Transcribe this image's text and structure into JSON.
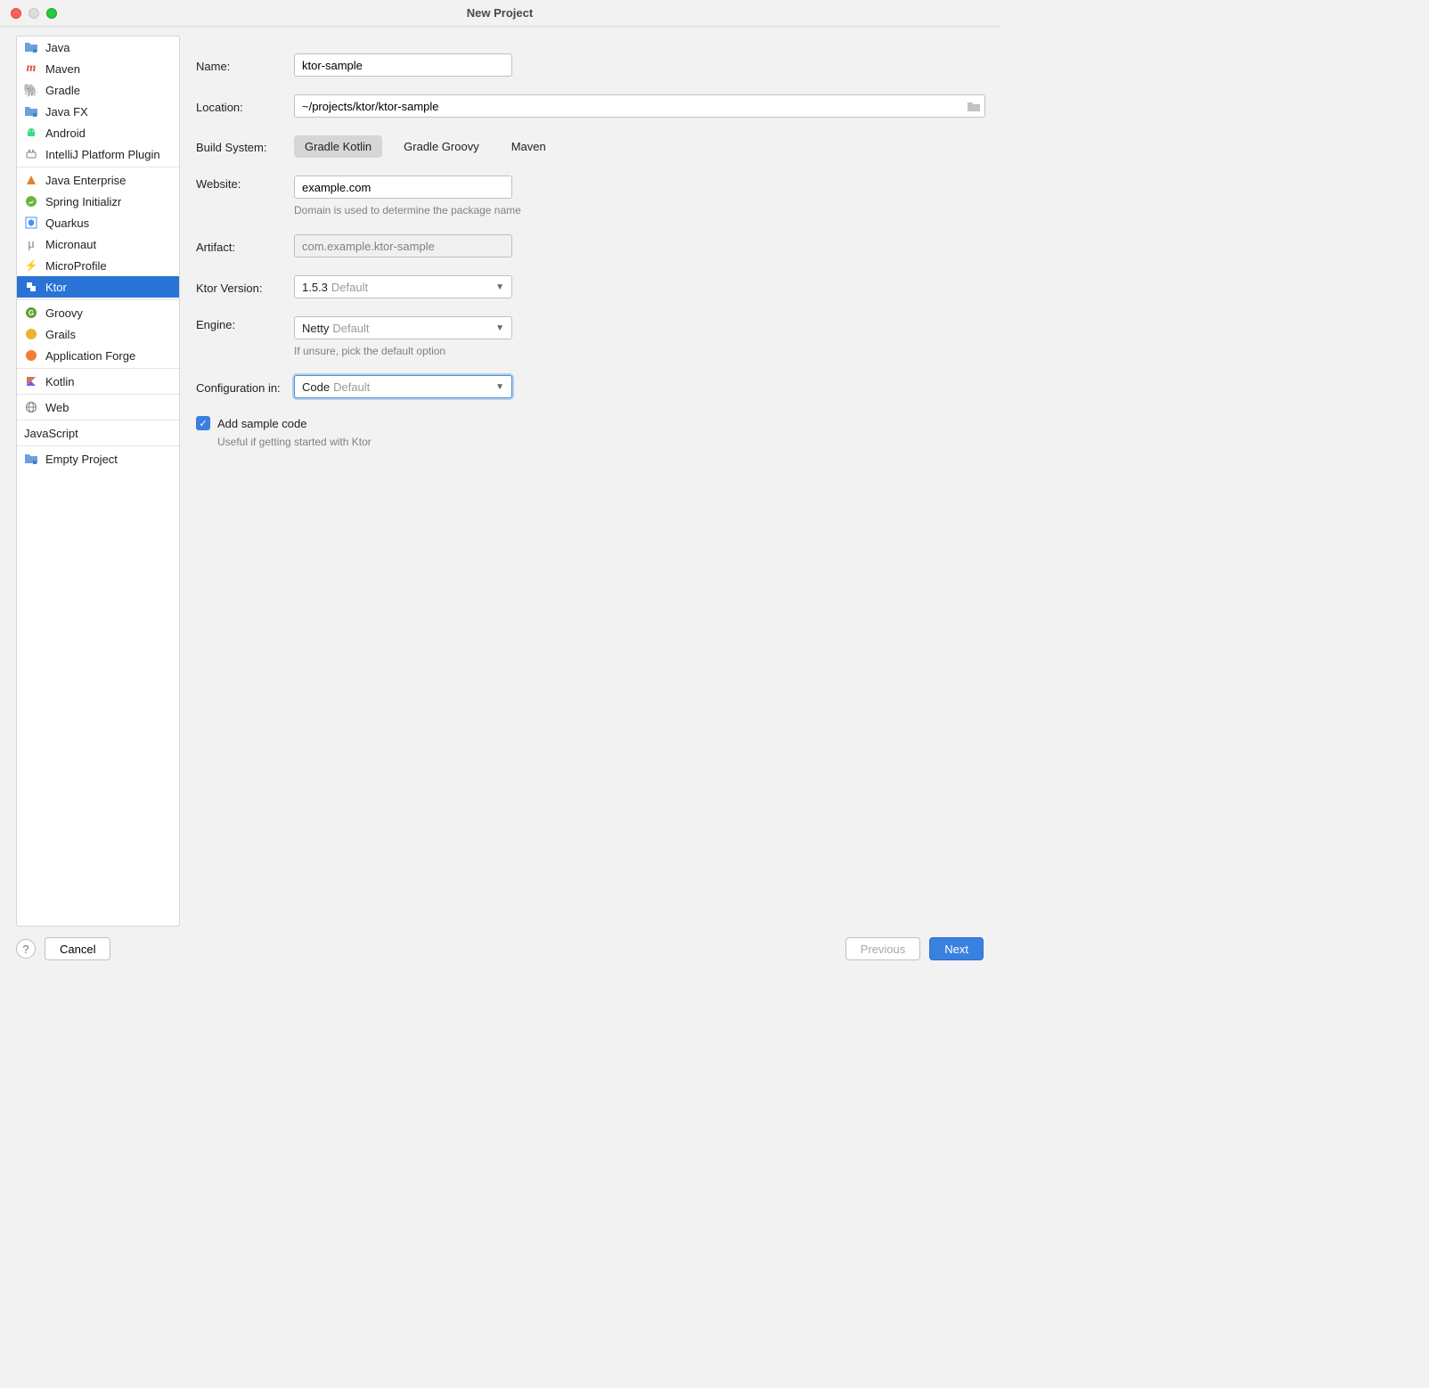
{
  "title": "New Project",
  "sidebar": {
    "groups": [
      [
        {
          "label": "Java",
          "icon": "folder-blue"
        },
        {
          "label": "Maven",
          "icon": "maven"
        },
        {
          "label": "Gradle",
          "icon": "gradle"
        },
        {
          "label": "Java FX",
          "icon": "folder-blue"
        },
        {
          "label": "Android",
          "icon": "android"
        },
        {
          "label": "IntelliJ Platform Plugin",
          "icon": "plugin"
        }
      ],
      [
        {
          "label": "Java Enterprise",
          "icon": "jee"
        },
        {
          "label": "Spring Initializr",
          "icon": "spring"
        },
        {
          "label": "Quarkus",
          "icon": "quarkus"
        },
        {
          "label": "Micronaut",
          "icon": "micronaut"
        },
        {
          "label": "MicroProfile",
          "icon": "microprofile"
        },
        {
          "label": "Ktor",
          "icon": "ktor",
          "selected": true
        }
      ],
      [
        {
          "label": "Groovy",
          "icon": "groovy"
        },
        {
          "label": "Grails",
          "icon": "grails"
        },
        {
          "label": "Application Forge",
          "icon": "forge"
        }
      ],
      [
        {
          "label": "Kotlin",
          "icon": "kotlin"
        }
      ],
      [
        {
          "label": "Web",
          "icon": "web"
        }
      ],
      [
        {
          "label": "JavaScript",
          "group": true
        }
      ],
      [
        {
          "label": "Empty Project",
          "icon": "folder-blue"
        }
      ]
    ]
  },
  "form": {
    "name_label": "Name:",
    "name_value": "ktor-sample",
    "location_label": "Location:",
    "location_value": "~/projects/ktor/ktor-sample",
    "buildsystem_label": "Build System:",
    "buildsystem_options": [
      "Gradle Kotlin",
      "Gradle Groovy",
      "Maven"
    ],
    "buildsystem_selected": 0,
    "website_label": "Website:",
    "website_value": "example.com",
    "website_hint": "Domain is used to determine the package name",
    "artifact_label": "Artifact:",
    "artifact_value": "com.example.ktor-sample",
    "ktorversion_label": "Ktor Version:",
    "ktorversion_value": "1.5.3",
    "engine_label": "Engine:",
    "engine_value": "Netty",
    "engine_hint": "If unsure, pick the default option",
    "config_label": "Configuration in:",
    "config_value": "Code",
    "default_suffix": "Default",
    "sample_label": "Add sample code",
    "sample_hint": "Useful if getting started with Ktor"
  },
  "footer": {
    "cancel": "Cancel",
    "previous": "Previous",
    "next": "Next"
  }
}
